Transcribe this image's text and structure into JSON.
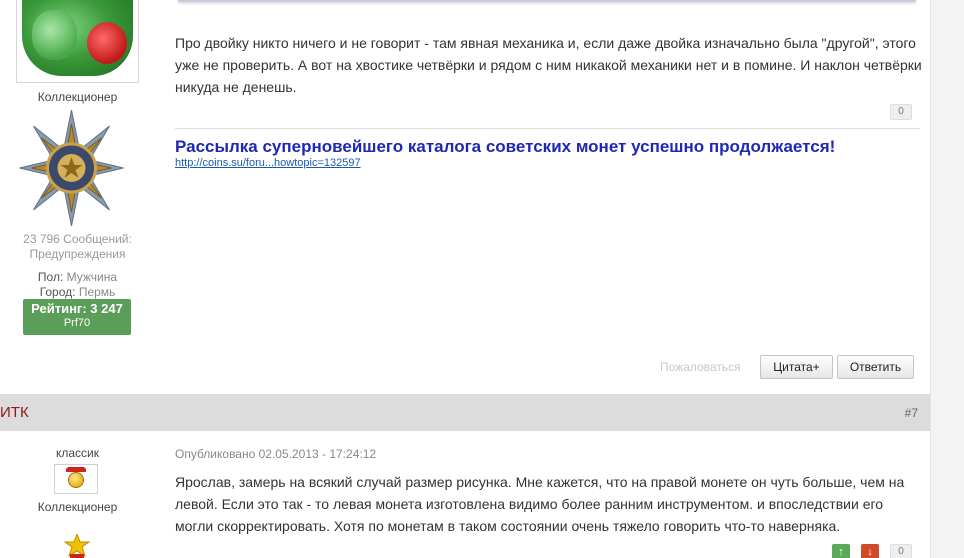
{
  "post1": {
    "user_group": "Коллекционер",
    "stats_posts": "23 796 Сообщений:",
    "stats_warnings": "Предупреждения",
    "gender_label": "Пол:",
    "gender_value": "Мужчина",
    "city_label": "Город:",
    "city_value": "Пермь",
    "rating": "Рейтинг: 3 247",
    "rating_user": "Prf70",
    "text": "Про двойку никто ничего и не говорит - там явная механика и, если даже двойка изначально была \"другой\", этого уже не проверить. А вот на хвостике четвёрки и рядом с ним никакой механики нет и в помине. И наклон четвёрки никуда не денешь.",
    "rep": "0",
    "signature_title": "Рассылка суперновейшего каталога советских монет успешно продолжается!",
    "signature_link": "http://coins.su/foru...howtopic=132597",
    "report": "Пожаловаться",
    "quote_button": "Цитата+",
    "reply_button": "Ответить"
  },
  "post2": {
    "author": "ИТК",
    "number": "#7",
    "rank": "классик",
    "user_group": "Коллекционер",
    "date": "Опубликовано 02.05.2013 - 17:24:12",
    "text": "Ярослав, замерь на всякий случай размер рисунка. Мне кажется, что на правой монете он чуть больше, чем на левой. Если это так - то левая монета изготовлена видимо более ранним инструментом. и впоследствии его могли скорректировать. Хотя по монетам в таком состоянии очень тяжело говорить что-то наверняка.",
    "vote_up": "↑",
    "vote_down": "↓",
    "rep": "0"
  },
  "colors": {
    "signature": "#1e28b4",
    "rating_bg": "#5a9e5a",
    "author": "#8b1a1a"
  }
}
